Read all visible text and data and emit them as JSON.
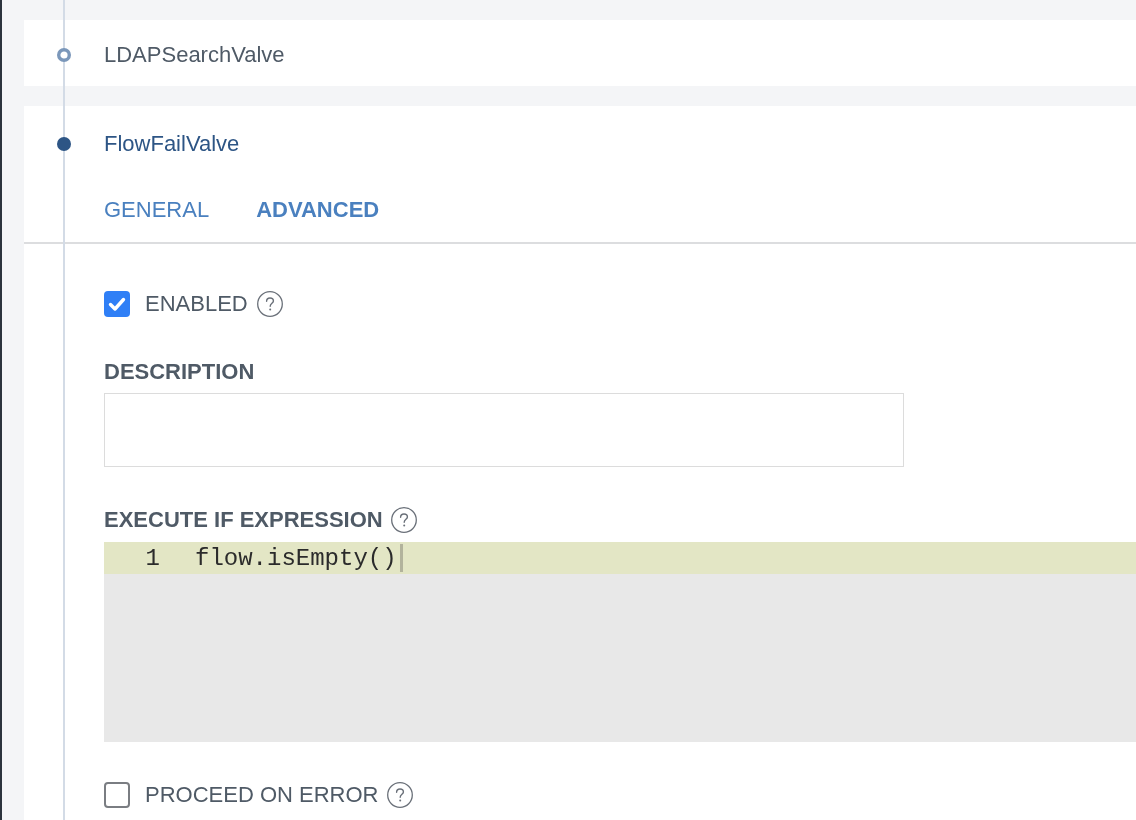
{
  "valves": [
    {
      "name": "LDAPSearchValve",
      "selected": false
    },
    {
      "name": "FlowFailValve",
      "selected": true,
      "tabs": [
        {
          "label": "GENERAL",
          "selected": false
        },
        {
          "label": "ADVANCED",
          "selected": true
        }
      ],
      "fields": [
        {
          "kind": "checkbox",
          "label": "ENABLED",
          "checked": true,
          "help": true
        },
        {
          "kind": "textarea",
          "label": "DESCRIPTION"
        },
        {
          "kind": "code",
          "label": "EXECUTE IF EXPRESSION",
          "help": true,
          "lines": [
            {
              "number": "1",
              "code": "flow.isEmpty()",
              "active": true
            }
          ]
        },
        {
          "kind": "checkbox",
          "label": "PROCEED ON ERROR",
          "checked": false,
          "help": true
        }
      ]
    }
  ]
}
